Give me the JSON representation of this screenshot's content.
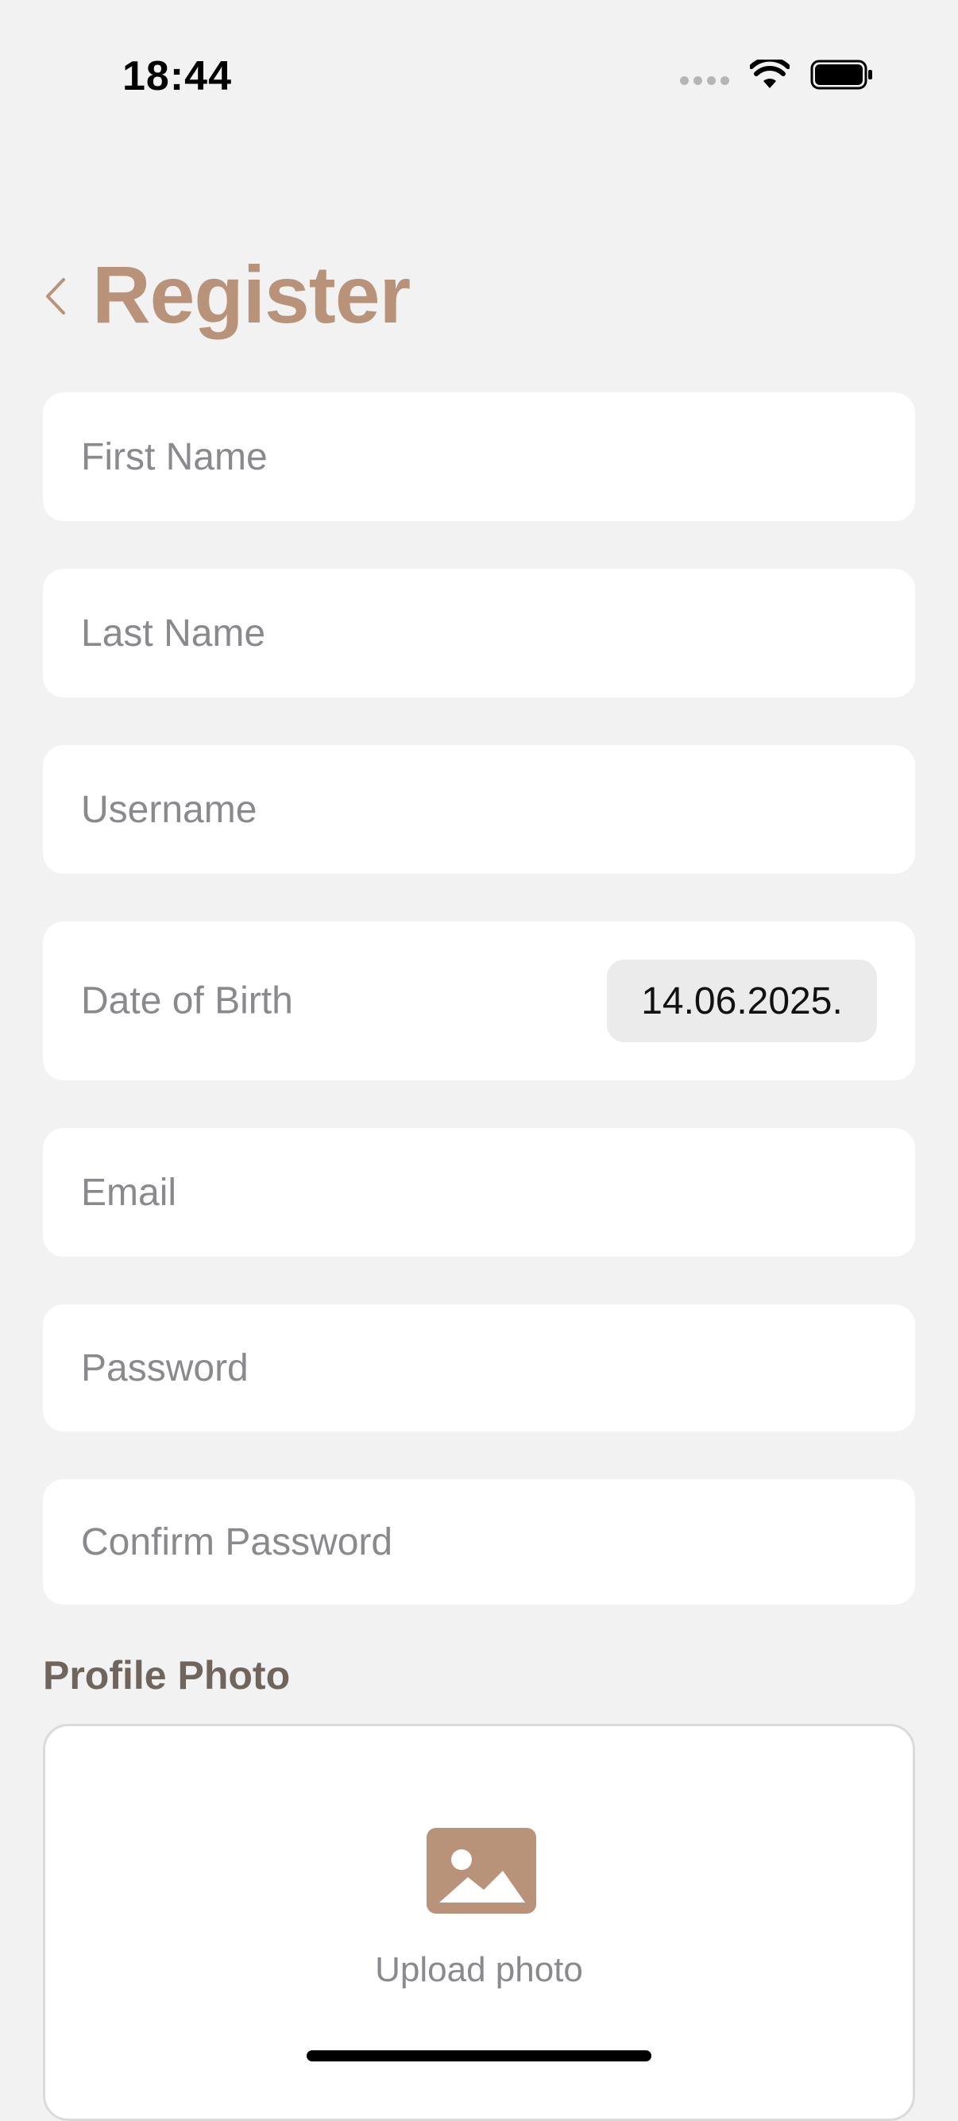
{
  "status_bar": {
    "time": "18:44"
  },
  "header": {
    "title": "Register"
  },
  "form": {
    "first_name": {
      "placeholder": "First Name",
      "value": ""
    },
    "last_name": {
      "placeholder": "Last Name",
      "value": ""
    },
    "username": {
      "placeholder": "Username",
      "value": ""
    },
    "date_of_birth": {
      "label": "Date of Birth",
      "value": "14.06.2025."
    },
    "email": {
      "placeholder": "Email",
      "value": ""
    },
    "password": {
      "placeholder": "Password",
      "value": ""
    },
    "confirm_password": {
      "placeholder": "Confirm Password",
      "value": ""
    }
  },
  "profile_photo": {
    "label": "Profile Photo",
    "upload_text": "Upload photo",
    "icon": "photo-icon"
  },
  "colors": {
    "accent": "#b8937a",
    "background": "#f2f2f2",
    "field_bg": "#ffffff",
    "placeholder": "#8a8a8e",
    "section_label": "#6f655d"
  }
}
